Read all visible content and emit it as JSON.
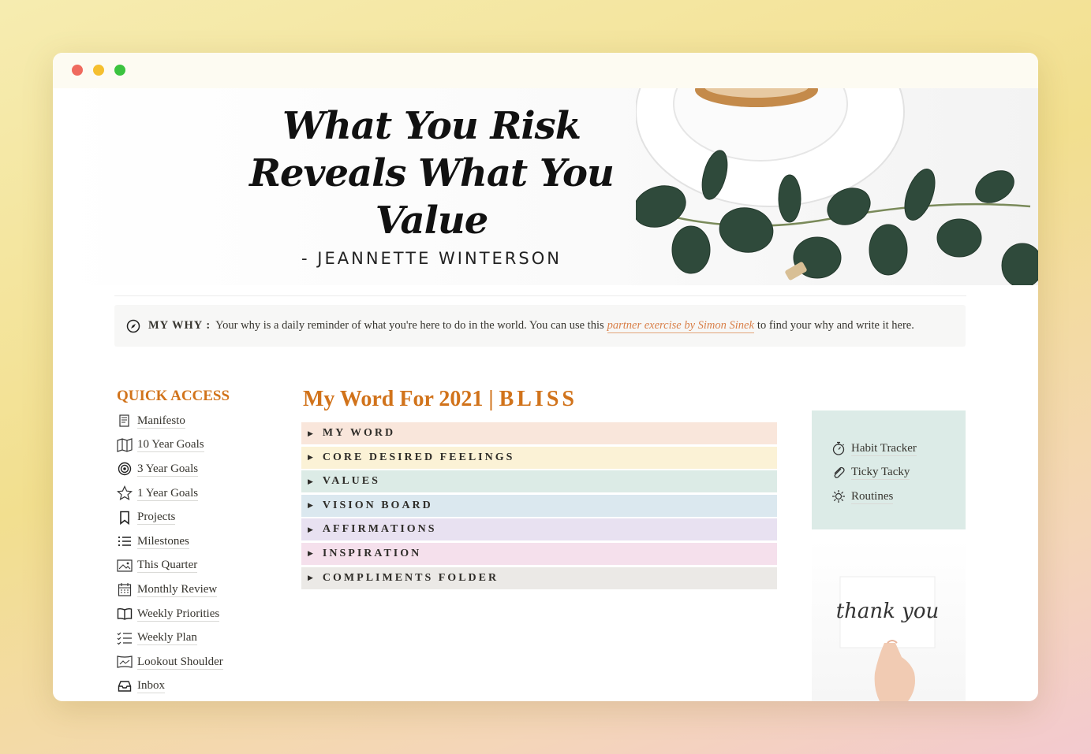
{
  "banner": {
    "quote_line1": "What You Risk",
    "quote_line2": "Reveals What You Value",
    "quote_author": "- JEANNETTE WINTERSON"
  },
  "callout": {
    "label": "MY WHY :",
    "text_before": "Your why is a daily reminder of what you're here to do in the world. You can use this",
    "link_text": "partner exercise by Simon Sinek",
    "text_after": "to find your why and write it here.",
    "link_color": "#d9804a"
  },
  "quick_access": {
    "title": "QUICK ACCESS",
    "items": [
      {
        "label": "Manifesto",
        "icon": "scroll-icon"
      },
      {
        "label": "10 Year Goals",
        "icon": "map-icon"
      },
      {
        "label": "3 Year Goals",
        "icon": "target-icon"
      },
      {
        "label": "1 Year Goals",
        "icon": "star-icon"
      },
      {
        "label": "Projects",
        "icon": "bookmark-icon"
      },
      {
        "label": "Milestones",
        "icon": "list-icon"
      },
      {
        "label": "This Quarter",
        "icon": "picture-icon"
      },
      {
        "label": "Monthly Review",
        "icon": "calendar-icon"
      },
      {
        "label": "Weekly Priorities",
        "icon": "book-icon"
      },
      {
        "label": "Weekly Plan",
        "icon": "checklist-icon"
      },
      {
        "label": "Lookout Shoulder",
        "icon": "frame-icon"
      },
      {
        "label": "Inbox",
        "icon": "inbox-icon"
      }
    ]
  },
  "word": {
    "title_prefix": "My Word For 2021 |",
    "title_word": "BLISS",
    "accent_color": "#d1731b",
    "toggles": [
      {
        "label": "MY WORD",
        "color": "#f9e6db"
      },
      {
        "label": "CORE DESIRED FEELINGS",
        "color": "#fbf2d6"
      },
      {
        "label": "VALUES",
        "color": "#dcebe6"
      },
      {
        "label": "VISION BOARD",
        "color": "#dbe8ef"
      },
      {
        "label": "AFFIRMATIONS",
        "color": "#e8e1f1"
      },
      {
        "label": "INSPIRATION",
        "color": "#f5e0ec"
      },
      {
        "label": "COMPLIMENTS FOLDER",
        "color": "#ebe9e6"
      }
    ]
  },
  "side": {
    "items": [
      {
        "label": "Habit Tracker",
        "icon": "stopwatch-icon"
      },
      {
        "label": "Ticky Tacky",
        "icon": "paperclip-icon"
      },
      {
        "label": "Routines",
        "icon": "sun-icon"
      }
    ],
    "card_text": "thank you"
  }
}
